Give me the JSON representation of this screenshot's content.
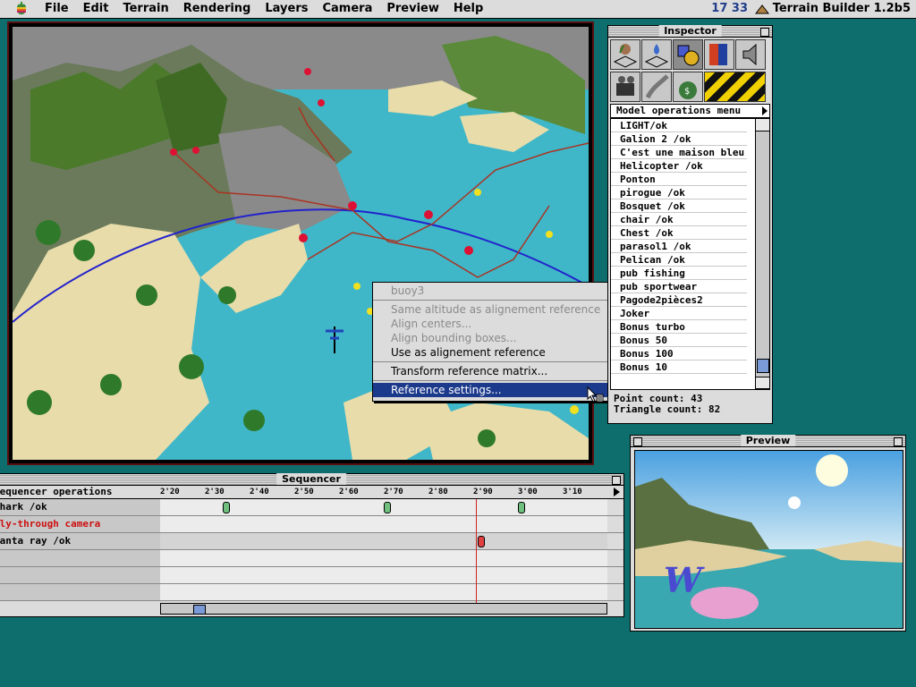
{
  "menubar": {
    "items": [
      "File",
      "Edit",
      "Terrain",
      "Rendering",
      "Layers",
      "Camera",
      "Preview",
      "Help"
    ],
    "clock": "17 33",
    "app_name": "Terrain Builder 1.2b5"
  },
  "inspector": {
    "title": "Inspector",
    "menu_label": "Model operations menu",
    "models": [
      "LIGHT/ok",
      "Galion 2 /ok",
      "C'est une maison bleu /ok",
      "Helicopter /ok",
      "Ponton",
      "pirogue /ok",
      "Bosquet /ok",
      "chair /ok",
      "Chest /ok",
      "parasol1 /ok",
      "Pelican /ok",
      "pub fishing",
      "pub sportwear",
      "Pagode2pièces2",
      "Joker",
      "Bonus turbo",
      "Bonus 50",
      "Bonus 100",
      "Bonus 10"
    ],
    "point_count": "Point count: 43",
    "triangle_count": "Triangle count: 82"
  },
  "preview": {
    "title": "Preview"
  },
  "sequencer": {
    "title": "Sequencer",
    "header_label": "Sequencer operations",
    "ticks": [
      "2'20",
      "2'30",
      "2'40",
      "2'50",
      "2'60",
      "2'70",
      "2'80",
      "2'90",
      "3'00",
      "3'10"
    ],
    "rows": [
      {
        "label": "Shark /ok",
        "red": false
      },
      {
        "label": "Fly-through camera",
        "red": true
      },
      {
        "label": "Manta ray /ok",
        "red": false
      },
      {
        "label": "",
        "red": false
      },
      {
        "label": "",
        "red": false
      },
      {
        "label": "",
        "red": false
      }
    ]
  },
  "context_menu": {
    "header": "buoy3",
    "items": [
      {
        "label": "Same altitude as alignement reference",
        "disabled": true
      },
      {
        "label": "Align centers...",
        "disabled": true
      },
      {
        "label": "Align bounding boxes...",
        "disabled": true
      },
      {
        "label": "Use as alignement reference",
        "disabled": false
      },
      {
        "label": "Transform reference matrix...",
        "disabled": false
      },
      {
        "label": "Reference settings...",
        "disabled": false,
        "highlighted": true
      }
    ]
  }
}
